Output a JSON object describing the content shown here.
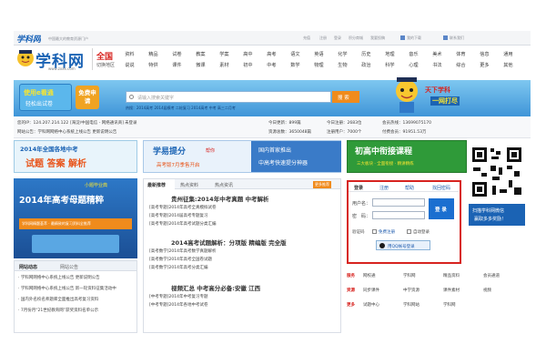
{
  "topbar": {
    "logo": "学科网",
    "slogan": "中国最大的教育资源门户",
    "links": [
      "充值",
      "注册",
      "登录",
      "积分商城",
      "我要投稿"
    ],
    "download_label": "我的下载",
    "contact_label": "联系我们"
  },
  "header": {
    "logo": "学科网",
    "logo_url": "www.zxxk.com",
    "region_title": "全国",
    "region_sub": "切换地区",
    "nav_rows": [
      [
        "资料",
        "精品",
        "试卷",
        "教案",
        "学案",
        "高中",
        "高考",
        "语文",
        "英语",
        "化学",
        "历史",
        "地理",
        "音乐",
        "美术",
        "体育",
        "信息",
        "通用"
      ],
      [
        "说说",
        "特供",
        "课件",
        "微课",
        "素材",
        "初中",
        "中考",
        "数学",
        "物理",
        "生物",
        "政治",
        "科学",
        "心理",
        "书法",
        "综合",
        "更多",
        "其他"
      ]
    ]
  },
  "banner": {
    "app_promo": "使用e看通",
    "app_promo_sub": "轻松出试卷",
    "free_apply": "免费申请",
    "search_placeholder": "请输入搜索关键字",
    "search_button": "搜 索",
    "hot_links": "热搜：2014高考 2014届模考 二轮复习 2014高考 中考 高三二月考",
    "mascot_title": "天下学科",
    "mascot_sub": "一网打尽"
  },
  "infobar": {
    "ip": "您的IP：124.207.214.122",
    "isp": "[海淀/中国电信 - 网络通讯商]",
    "user_status": "未登录",
    "stat_today": "今日更新：899篇",
    "stat_today_value": "899",
    "stat_users": "今日注册：2683位",
    "stat_users_value": "2683",
    "member_phone": "会员热线：13699075170",
    "total_res": "资源总数：3650048篇",
    "total_users": "注册用户：7000个",
    "members": "付费会员：91951.53万",
    "notice": "网站公告：学科网网络中心系统上线公告 更新说明公告"
  },
  "promos": {
    "left_title": "2014年全国各地中考",
    "left_sub": "试题 答案 解析",
    "middle_title": "学易提分",
    "middle_tag": "帮你",
    "middle_sub": "高考版7月季售开启",
    "middle_right_1": "国内首家推出",
    "middle_right_2": "中高考快速提分神器",
    "right_title": "初高中衔接课程",
    "right_sub": "三大板块 · 全面衔接 · 精讲精练"
  },
  "left_column": {
    "promo_tag": "小题毕业典",
    "promo_title": "2014年高考母题精粹",
    "promo_sub": "学科网精题荟萃 · 最精致的复习资料全推荐",
    "news_tab_1": "网站动态",
    "news_tab_2": "网站公告",
    "news": [
      "学科网网络中心系统上线公告 更新说明公告",
      "学科网网络中心系统上线公告 新一轮资料征集活动中",
      "国内外名校名师题库全面推出高考复习资料",
      "7月份月“21世纪教育网”获奖资料名单公示"
    ]
  },
  "center_column": {
    "tabs": [
      "最新推荐",
      "热点资料",
      "热点资讯"
    ],
    "more": "更多推荐",
    "headline_1": "贵州征集:2014年中考真题 中考解析",
    "items_1": [
      "[高考专题]2014年高考全真模拟试卷",
      "[高考专题]2014届高考专题复习",
      "[高考专题]2014年高考试题分类汇编"
    ],
    "headline_2": "2014高考试题解析：分项版 精编版 完全版",
    "items_2": [
      "[高考数学]2014年高考数学真题解析",
      "[高考数学]2014年高考全国卷试题",
      "[高考数学]2014年高考分类汇编"
    ],
    "headline_3": "视频汇总 中考高分必备:安徽 江西",
    "items_3": [
      "[中考专题]2014年中考复习专题",
      "[中考专题]2014年各地中考试卷"
    ]
  },
  "login": {
    "tabs": [
      "登录",
      "注册",
      "帮助",
      "找回密码"
    ],
    "user_label": "用户名：",
    "pass_label": "密　码：",
    "login_button": "登 录",
    "verify_label": "验证码",
    "verify_check": "免费注册",
    "remember_label": "自动登录",
    "qq_login": "用QQ帐号登录"
  },
  "right_column": {
    "qr_caption_1": "扫描学科网微信",
    "qr_caption_2": "赢取多多奖励！",
    "nav_rows": [
      [
        "服务",
        "网校通",
        "学科网",
        "精品资料",
        "会员通道"
      ],
      [
        "资源",
        "同步课件",
        "中学资源",
        "课件素材",
        "视频"
      ],
      [
        "更多",
        "试题中心",
        "学科网站",
        "学科网"
      ]
    ]
  }
}
